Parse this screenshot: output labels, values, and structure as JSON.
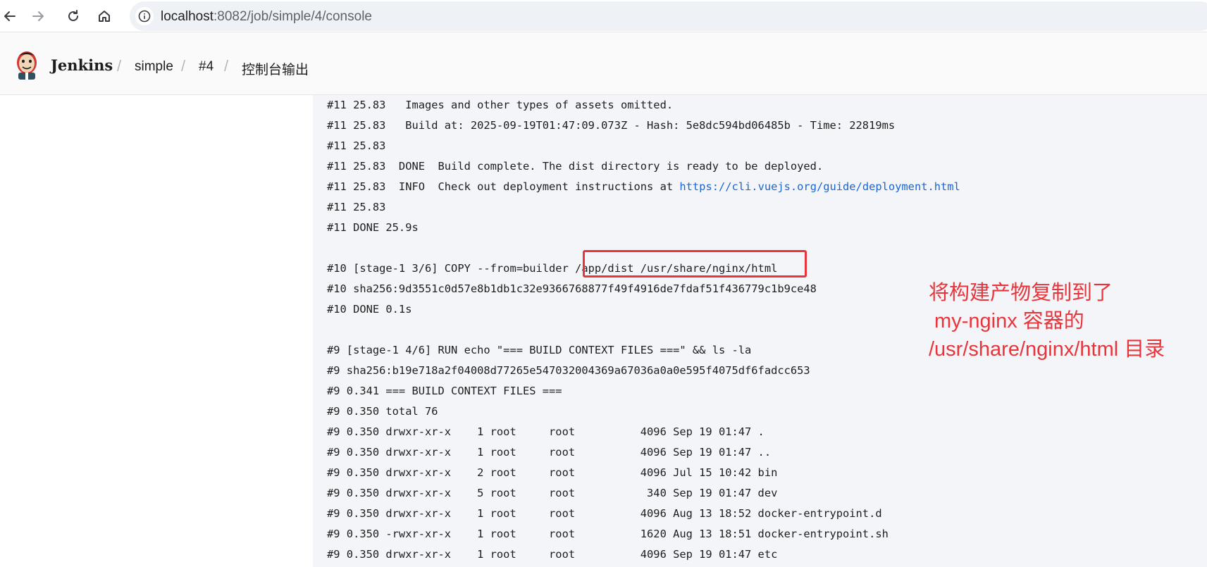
{
  "browser": {
    "url": "localhost:8082/job/simple/4/console",
    "url_host": "localhost",
    "url_rest": ":8082/job/simple/4/console",
    "icons": [
      "back-icon",
      "forward-icon",
      "reload-icon",
      "home-icon",
      "info-icon"
    ]
  },
  "header": {
    "brand": "Jenkins",
    "breadcrumbs": [
      "simple",
      "#4",
      "控制台输出"
    ],
    "separator": "/"
  },
  "console": {
    "lines": [
      {
        "text": "#11 25.83   Images and other types of assets omitted."
      },
      {
        "text": "#11 25.83   Build at: 2025-09-19T01:47:09.073Z - Hash: 5e8dc594bd06485b - Time: 22819ms"
      },
      {
        "text": "#11 25.83"
      },
      {
        "text": "#11 25.83  DONE  Build complete. The dist directory is ready to be deployed."
      },
      {
        "text": "#11 25.83  INFO  Check out deployment instructions at ",
        "link": "https://cli.vuejs.org/guide/deployment.html"
      },
      {
        "text": "#11 25.83"
      },
      {
        "text": "#11 DONE 25.9s"
      },
      {
        "text": ""
      },
      {
        "text": "#10 [stage-1 3/6] COPY --from=builder /app/dist /usr/share/nginx/html"
      },
      {
        "text": "#10 sha256:9d3551c0d57e8b1db1c32e9366768877f49f4916de7fdaf51f436779c1b9ce48"
      },
      {
        "text": "#10 DONE 0.1s"
      },
      {
        "text": ""
      },
      {
        "text": "#9 [stage-1 4/6] RUN echo \"=== BUILD CONTEXT FILES ===\" && ls -la"
      },
      {
        "text": "#9 sha256:b19e718a2f04008d77265e547032004369a67036a0a0e595f4075df6fadcc653"
      },
      {
        "text": "#9 0.341 === BUILD CONTEXT FILES ==="
      },
      {
        "text": "#9 0.350 total 76"
      },
      {
        "text": "#9 0.350 drwxr-xr-x    1 root     root          4096 Sep 19 01:47 ."
      },
      {
        "text": "#9 0.350 drwxr-xr-x    1 root     root          4096 Sep 19 01:47 .."
      },
      {
        "text": "#9 0.350 drwxr-xr-x    2 root     root          4096 Jul 15 10:42 bin"
      },
      {
        "text": "#9 0.350 drwxr-xr-x    5 root     root           340 Sep 19 01:47 dev"
      },
      {
        "text": "#9 0.350 drwxr-xr-x    1 root     root          4096 Aug 13 18:52 docker-entrypoint.d"
      },
      {
        "text": "#9 0.350 -rwxr-xr-x    1 root     root          1620 Aug 13 18:51 docker-entrypoint.sh"
      },
      {
        "text": "#9 0.350 drwxr-xr-x    1 root     root          4096 Sep 19 01:47 etc"
      }
    ]
  },
  "annotation": {
    "text": "将构建产物复制到了\n my-nginx 容器的\n/usr/share/nginx/html 目录",
    "color": "#e8353b"
  },
  "colors": {
    "link": "#1a66d2",
    "highlight": "#e8353b",
    "console_bg": "#f4f5f8"
  }
}
